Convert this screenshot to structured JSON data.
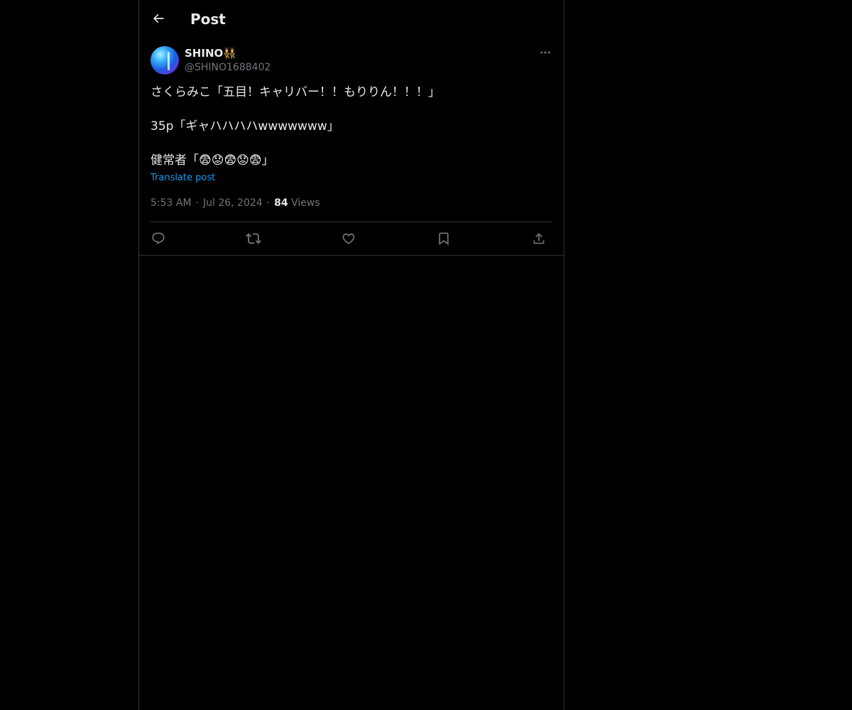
{
  "header": {
    "title": "Post",
    "back_icon": "arrow-left-icon"
  },
  "author": {
    "name": "SHINO👯",
    "handle": "@SHINO1688402",
    "avatar": "avatar-image"
  },
  "post": {
    "lines": [
      "さくらみこ「五目！キャリバー！！もりりん！！！」",
      "35p「ギャハハハハwwwwwww」",
      "健常者「😨😟😨😟😨」"
    ],
    "translate_label": "Translate post",
    "time": "5:53 AM",
    "date": "Jul 26, 2024",
    "views_count": "84",
    "views_label": "Views"
  },
  "actions": {
    "reply_icon": "reply-icon",
    "repost_icon": "repost-icon",
    "like_icon": "heart-icon",
    "bookmark_icon": "bookmark-icon",
    "share_icon": "share-icon"
  },
  "colors": {
    "background": "#000000",
    "text": "#e7e9ea",
    "secondary_text": "#71767b",
    "link": "#1d9bf0",
    "border": "#2f3336"
  }
}
